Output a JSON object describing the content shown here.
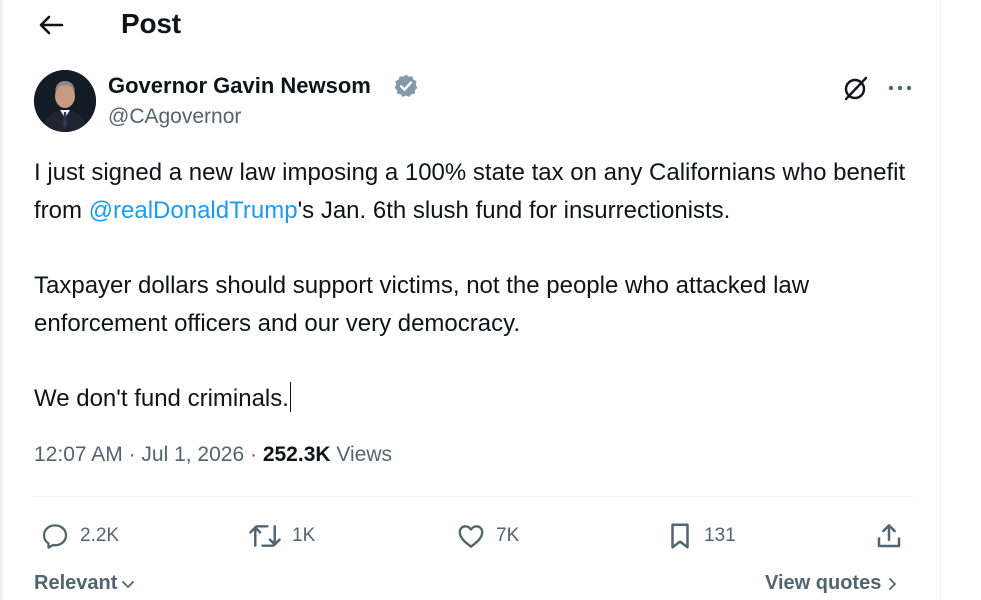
{
  "header": {
    "title": "Post"
  },
  "author": {
    "name": "Governor Gavin Newsom",
    "handle": "@CAgovernor"
  },
  "tweet": {
    "p1_before": "I just signed a new law imposing a 100% state tax on any Californians who benefit from ",
    "mention": "@realDonaldTrump",
    "p1_after": "'s Jan. 6th slush fund for insurrectionists.",
    "p2": "Taxpayer dollars should support victims, not the people who attacked law enforcement officers and our very democracy.",
    "p3": "We don't fund criminals."
  },
  "meta": {
    "time": "12:07 AM",
    "sep1": " · ",
    "date": "Jul 1, 2026",
    "sep2": " · ",
    "views_count": "252.3K",
    "views_label": " Views"
  },
  "actions": {
    "replies": "2.2K",
    "reposts": "1K",
    "likes": "7K",
    "bookmarks": "131"
  },
  "bottom": {
    "sort_label": "Relevant",
    "quotes_label": "View quotes"
  },
  "icons": {
    "back": "arrow-left-icon",
    "verified": "verified-badge-icon",
    "grok": "grok-icon",
    "more": "more-dots-icon",
    "reply": "reply-icon",
    "repost": "repost-icon",
    "like": "heart-icon",
    "bookmark": "bookmark-icon",
    "share": "share-icon"
  },
  "colors": {
    "link": "#1d9bf0",
    "verified": "#829aab",
    "muted": "#536471",
    "text": "#0f1419"
  }
}
